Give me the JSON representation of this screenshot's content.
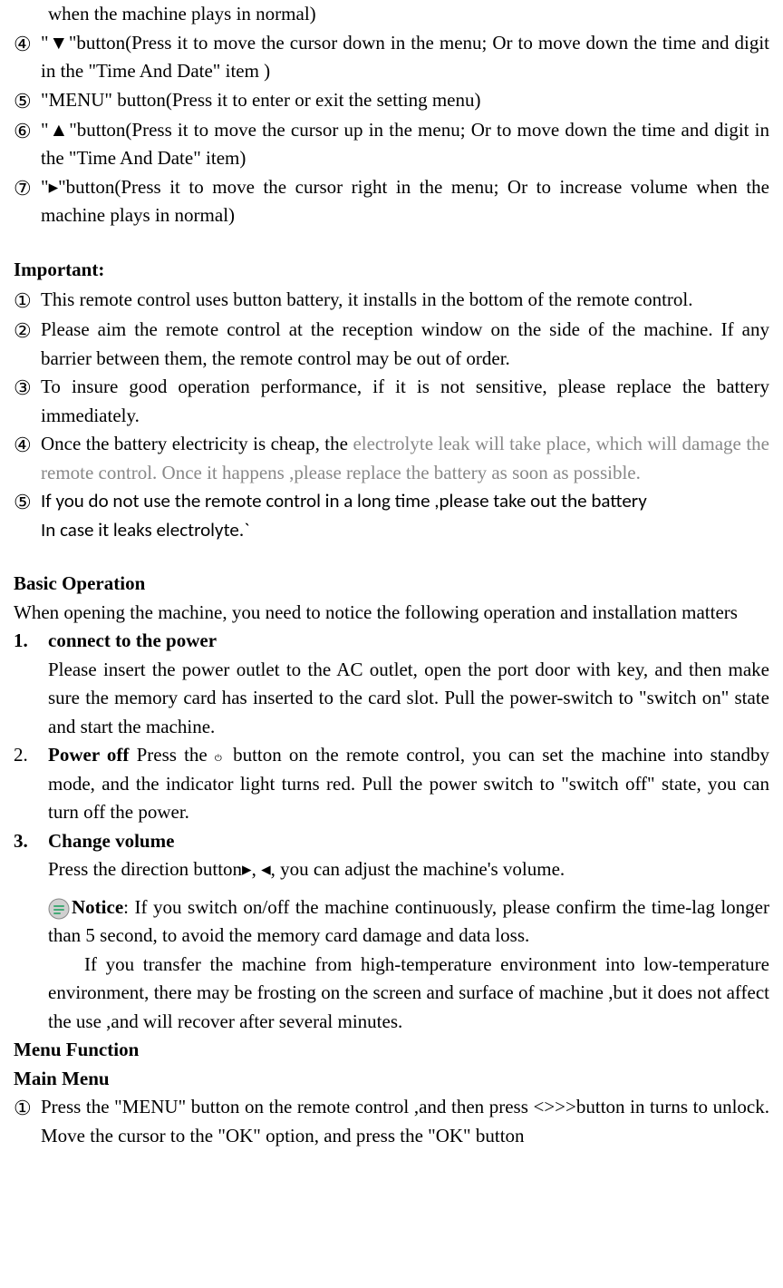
{
  "top_line": "when the machine plays in normal)",
  "items_top": [
    {
      "num": "④",
      "text": "\"▼\"button(Press it to move the cursor down in the menu; Or to move down the time and digit in the \"Time And Date\" item )"
    },
    {
      "num": "⑤",
      "text": "\"MENU\" button(Press it to enter or exit the setting menu)"
    },
    {
      "num": "⑥",
      "text": "\"▲\"button(Press it to move the cursor up in the menu; Or to move down the time and digit in the \"Time And Date\" item)"
    },
    {
      "num": "⑦",
      "text": "\"▸\"button(Press it to move the cursor right in the menu; Or to increase volume when the machine plays in normal)"
    }
  ],
  "important_heading": "Important:",
  "important_items": [
    {
      "num": "①",
      "text": "This remote control uses button battery, it installs in the bottom of the remote control."
    },
    {
      "num": "②",
      "text": "Please aim the remote control at the reception window on the side of the machine. If any barrier between them, the remote control may be out of order."
    },
    {
      "num": "③",
      "text": "To insure good operation performance, if it is not sensitive, please replace the battery immediately."
    },
    {
      "num": "④",
      "text_part1": "Once the battery electricity is cheap, the ",
      "text_part2": "electrolyte leak will take place, which will damage the remote control. Once it happens ,please replace the battery as soon as possible."
    },
    {
      "num": "⑤",
      "text_line1": "If you do not use the remote control in a long time ,please take out the battery",
      "text_line2": "In case it leaks electrolyte.`"
    }
  ],
  "basic_op_heading": "Basic Operation",
  "basic_op_intro": "When opening the machine, you need to notice the following operation and installation matters",
  "basic_items": [
    {
      "num": "1.",
      "title": "connect to the power",
      "text": "Please insert the power outlet to the AC outlet, open the port door with key, and then make sure the memory card has inserted to the card slot. Pull the power-switch to \"switch on\" state and start the machine."
    },
    {
      "num": "2.",
      "title": "Power off",
      "prefix": " Press the ",
      "suffix": " button on the remote control, you can set the machine into standby mode, and the indicator light turns red. Pull the power switch to \"switch off\" state, you can turn off the power."
    },
    {
      "num": "3.",
      "title": "Change volume",
      "text": "Press the direction button▸, ◂, you can adjust the machine's volume."
    }
  ],
  "notice_label": "Notice",
  "notice_text": ": If you switch on/off the machine continuously, please confirm the time-lag longer than 5 second, to avoid the memory card damage and data loss.",
  "temp_text": "If you transfer the machine from high-temperature environment into low-temperature environment, there may be frosting on the screen and surface of machine ,but it does not affect the use ,and will recover after several minutes.",
  "menu_function": "Menu Function",
  "main_menu": "Main Menu",
  "main_menu_items": [
    {
      "num": "①",
      "text": "Press the \"MENU\" button on the remote control ,and then press <>>>button in turns to unlock. Move the cursor to the \"OK\" option, and press the \"OK\" button"
    }
  ]
}
